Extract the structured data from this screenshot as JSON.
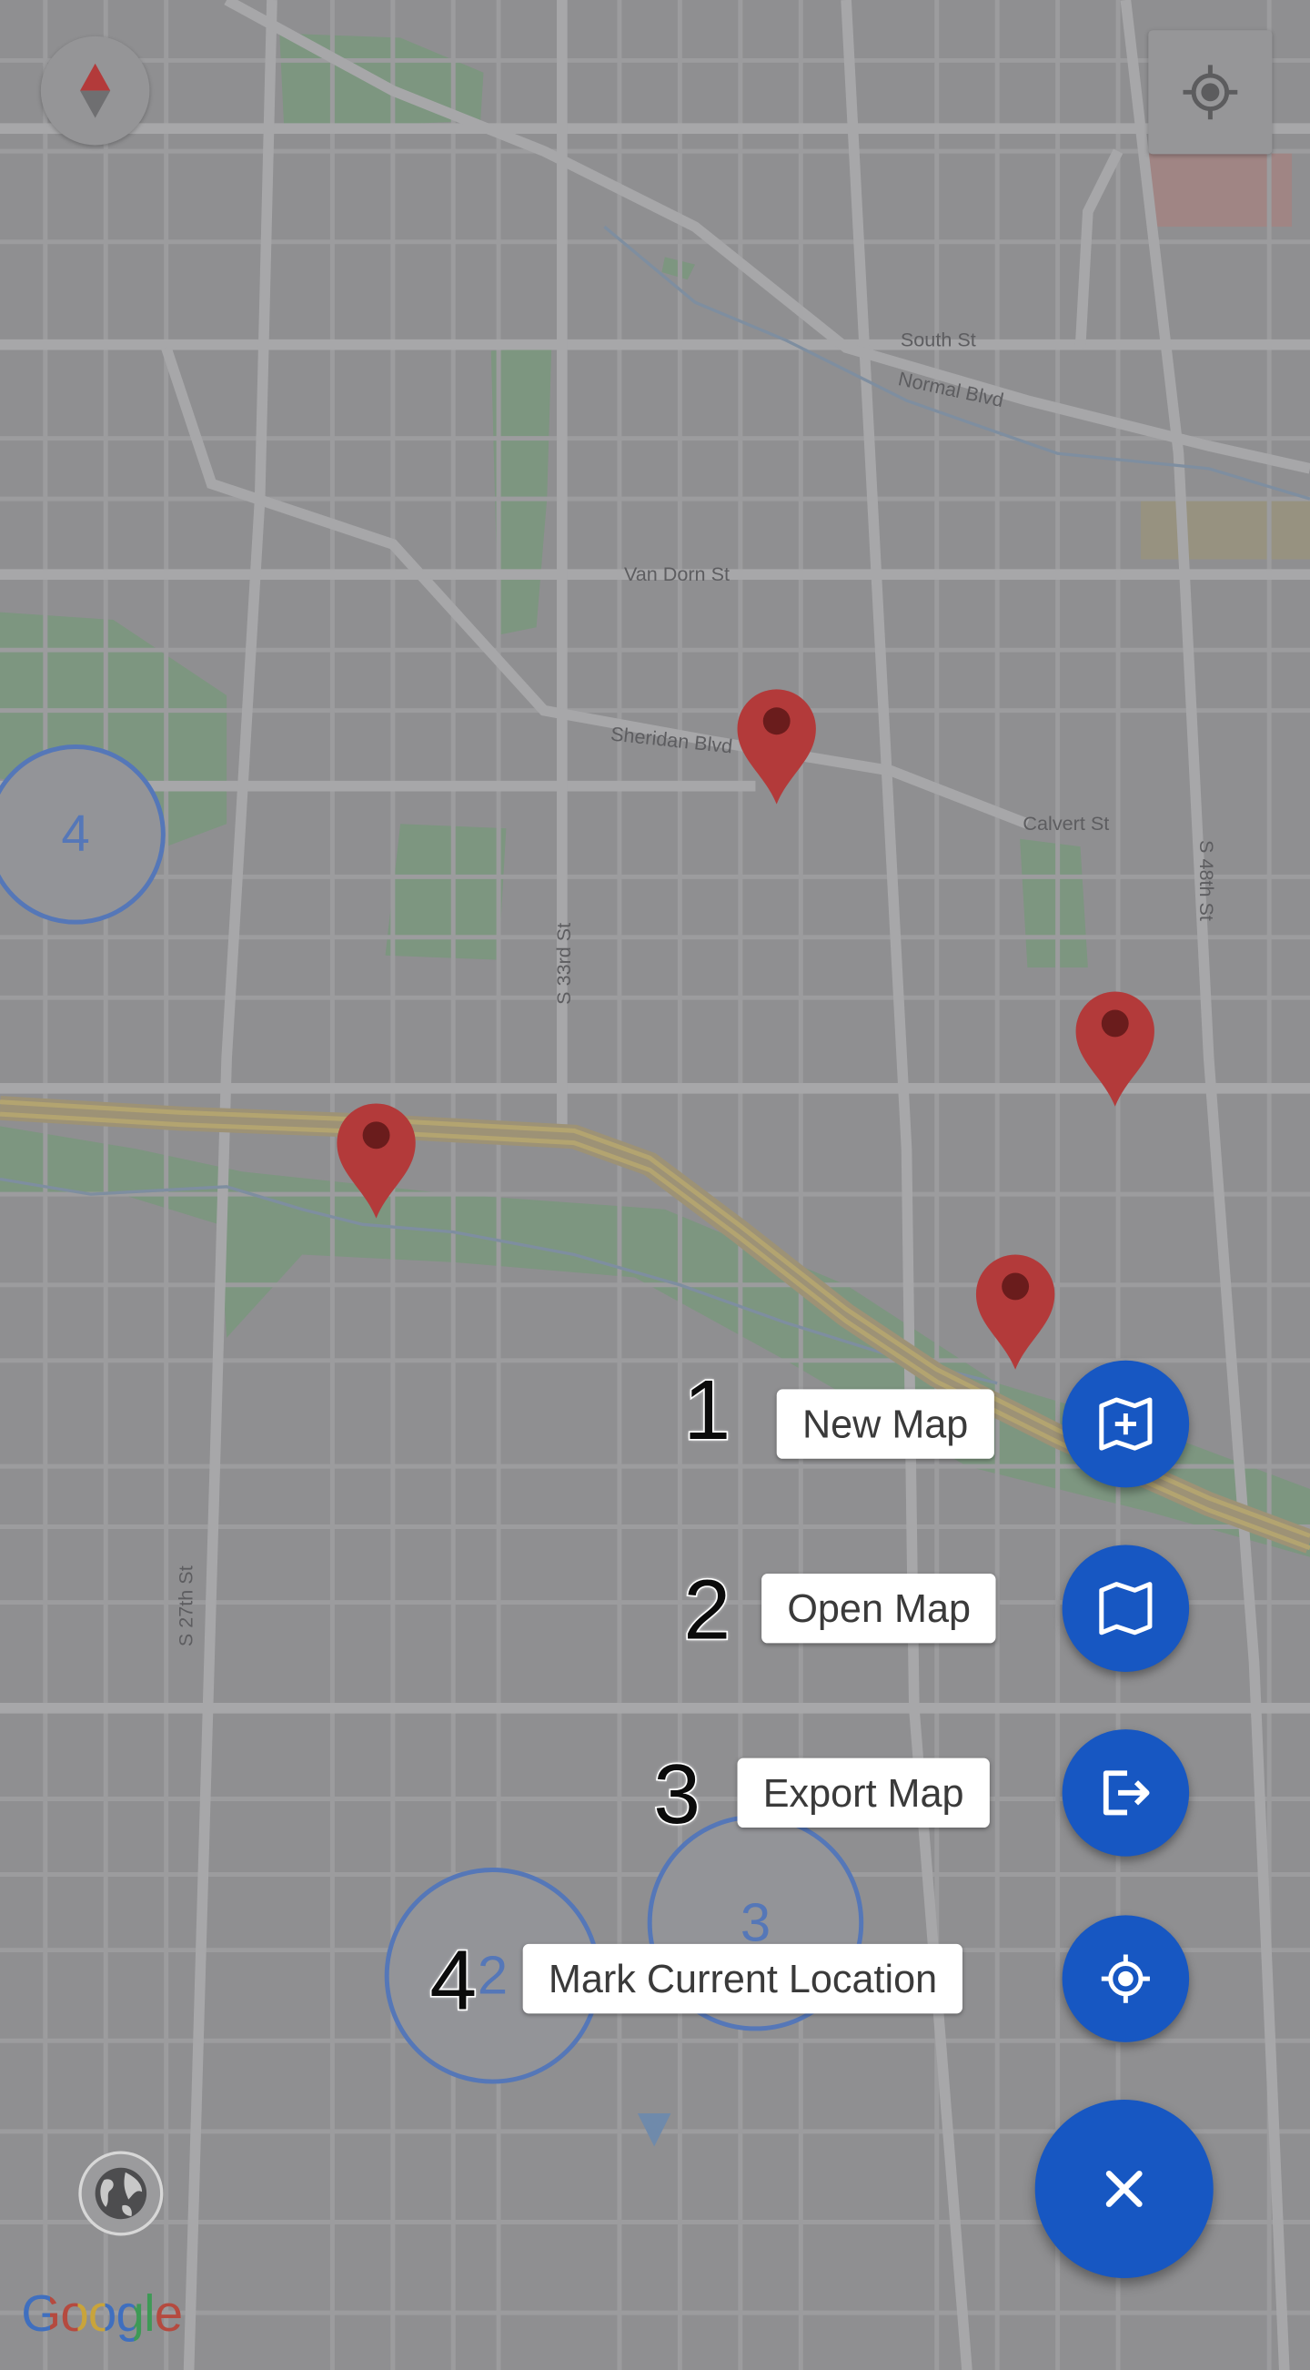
{
  "map": {
    "street_labels": {
      "south_st": "South St",
      "normal_blvd": "Normal Blvd",
      "van_dorn_st": "Van Dorn St",
      "sheridan_blvd": "Sheridan Blvd",
      "calvert_st": "Calvert St",
      "s_48th_st": "S 48th St",
      "s_33rd_st": "S 33rd St",
      "s_27th_st": "S 27th St"
    },
    "clusters": [
      {
        "count": "4"
      },
      {
        "count": "3"
      },
      {
        "count": "2"
      }
    ],
    "attribution": "Google",
    "colors": {
      "cluster_ring": "#5577b8",
      "marker": "#b33a3a",
      "fab": "#1757c2"
    }
  },
  "controls": {
    "compass_icon": "compass-icon",
    "my_location_icon": "crosshair-icon",
    "layers_icon": "globe-icon"
  },
  "fab_menu": {
    "items": [
      {
        "step": "1",
        "label": "New Map",
        "icon": "map-plus-icon"
      },
      {
        "step": "2",
        "label": "Open Map",
        "icon": "map-icon"
      },
      {
        "step": "3",
        "label": "Export Map",
        "icon": "export-icon"
      },
      {
        "step": "4",
        "label": "Mark Current Location",
        "icon": "location-target-icon"
      }
    ],
    "close_icon": "close-icon"
  }
}
